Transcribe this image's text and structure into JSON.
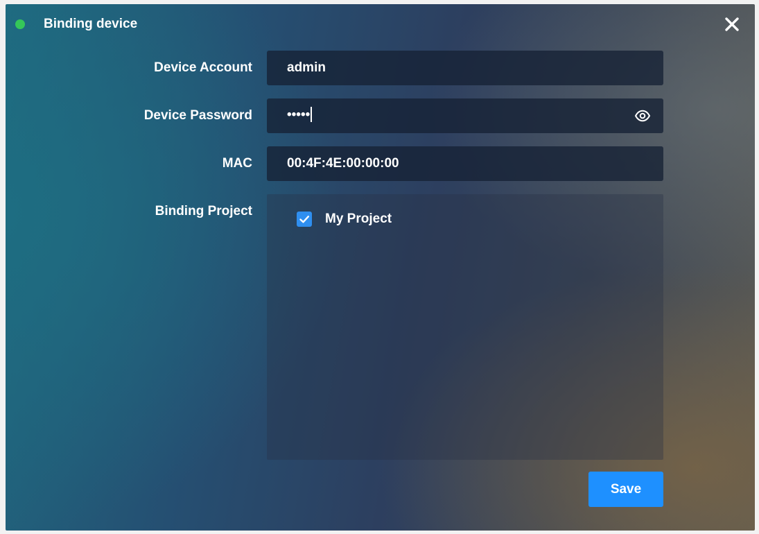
{
  "dialog": {
    "title": "Binding device",
    "status_color": "#35c759",
    "close_icon": "close-icon"
  },
  "form": {
    "account": {
      "label": "Device Account",
      "value": "admin"
    },
    "password": {
      "label": "Device Password",
      "value": "•••••",
      "toggle_icon": "eye-icon"
    },
    "mac": {
      "label": "MAC",
      "value": "00:4F:4E:00:00:00"
    },
    "project": {
      "label": "Binding Project",
      "options": [
        {
          "label": "My Project",
          "checked": true
        }
      ]
    }
  },
  "footer": {
    "save_label": "Save",
    "accent_color": "#1e90ff"
  }
}
